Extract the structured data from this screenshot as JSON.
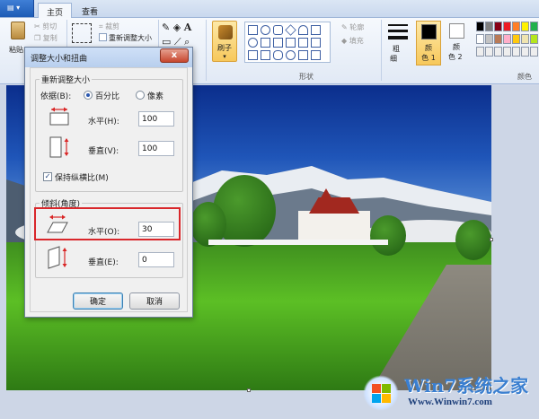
{
  "window": {
    "tabs": [
      {
        "label": "主页",
        "active": true
      },
      {
        "label": "查看",
        "active": false
      }
    ]
  },
  "ribbon": {
    "clipboard": {
      "paste_label": "粘贴",
      "cut_label": "剪切",
      "copy_label": "复制"
    },
    "image": {
      "crop_label": "裁剪",
      "resize_label": "重新调整大小"
    },
    "brushes": {
      "label": "刷子"
    },
    "shapes": {
      "outline_label": "轮廓",
      "fill_label": "填充",
      "group_label": "形状"
    },
    "size": {
      "label_top": "粗",
      "label_bottom": "细"
    },
    "colors": {
      "color1_label_top": "颜",
      "color1_label_bottom": "色 1",
      "color2_label_top": "颜",
      "color2_label_bottom": "色 2",
      "group_label": "颜色",
      "palette": [
        "#000000",
        "#7f7f7f",
        "#880015",
        "#ed1c24",
        "#ff7f27",
        "#fff200",
        "#22b14c",
        "#ffffff",
        "#c3c3c3",
        "#b97a57",
        "#ffaec9",
        "#ffc90e",
        "#efe4b0",
        "#b5e61d",
        "#eeeeee",
        "#eeeeee",
        "#eeeeee",
        "#eeeeee",
        "#eeeeee",
        "#eeeeee",
        "#eeeeee"
      ]
    }
  },
  "dialog": {
    "title": "调整大小和扭曲",
    "close_glyph": "x",
    "resize": {
      "legend": "重新调整大小",
      "by_label": "依据(B):",
      "percent_label": "百分比",
      "pixels_label": "像素",
      "selected": "percent",
      "horizontal_label": "水平(H):",
      "horizontal_value": "100",
      "vertical_label": "垂直(V):",
      "vertical_value": "100",
      "keep_ratio_label": "保持纵横比(M)",
      "keep_ratio_checked": true
    },
    "skew": {
      "legend": "倾斜(角度)",
      "horizontal_label": "水平(O):",
      "horizontal_value": "30",
      "vertical_label": "垂直(E):",
      "vertical_value": "0"
    },
    "ok_label": "确定",
    "cancel_label": "取消"
  },
  "watermark": {
    "title": "Win7系统之家",
    "url": "Www.Winwin7.com"
  }
}
